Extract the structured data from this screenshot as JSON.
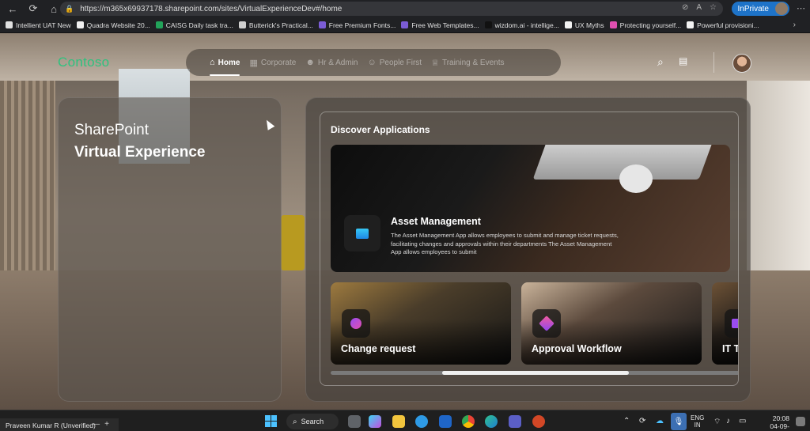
{
  "browser": {
    "url": "https://m365x69937178.sharepoint.com/sites/VirtualExperienceDev#/home",
    "inprivate_label": "InPrivate",
    "bookmarks": [
      {
        "label": "Intellient UAT New",
        "color": "#e0e0e0"
      },
      {
        "label": "Quadra Website 20...",
        "color": "#f0f0f0"
      },
      {
        "label": "CAISG Daily task tra...",
        "color": "#22a35a"
      },
      {
        "label": "Butterick's Practical...",
        "color": "#d0d0d0"
      },
      {
        "label": "Free Premium Fonts...",
        "color": "#7b5cd6"
      },
      {
        "label": "Free Web Templates...",
        "color": "#7b5cd6"
      },
      {
        "label": "wizdom.ai - intellige...",
        "color": "#111111"
      },
      {
        "label": "UX Myths",
        "color": "#f2f2f2"
      },
      {
        "label": "Protecting yourself...",
        "color": "#e04fb0"
      },
      {
        "label": "Powerful provisioni...",
        "color": "#f2f2f2"
      }
    ]
  },
  "header": {
    "logo": "Contoso",
    "nav": [
      {
        "label": "Home",
        "icon": "home-icon",
        "active": true
      },
      {
        "label": "Corporate",
        "icon": "building-icon",
        "active": false
      },
      {
        "label": "Hr & Admin",
        "icon": "people-icon",
        "active": false
      },
      {
        "label": "People First",
        "icon": "group-icon",
        "active": false
      },
      {
        "label": "Training & Events",
        "icon": "trophy-icon",
        "active": false
      }
    ]
  },
  "left_panel": {
    "title_line1": "SharePoint",
    "title_line2": "Virtual Experience"
  },
  "discover": {
    "title": "Discover Applications",
    "featured": {
      "title": "Asset Management",
      "description": "The Asset Management App allows employees to submit and manage ticket requests, facilitating changes and approvals within their departments The Asset Management App allows employees to submit"
    },
    "cards": [
      {
        "title": "Change request"
      },
      {
        "title": "Approval Workflow"
      },
      {
        "title": "IT Ti"
      }
    ],
    "scroll_progress": 0.5
  },
  "taskbar": {
    "user": "Praveen Kumar R (Unverified)",
    "search_label": "Search",
    "lang_line1": "ENG",
    "lang_line2": "IN",
    "time": "20:08",
    "date": "04-09-2025"
  },
  "colors": {
    "brand_green": "#2ec27e",
    "inprivate_blue": "#1e73c8"
  }
}
